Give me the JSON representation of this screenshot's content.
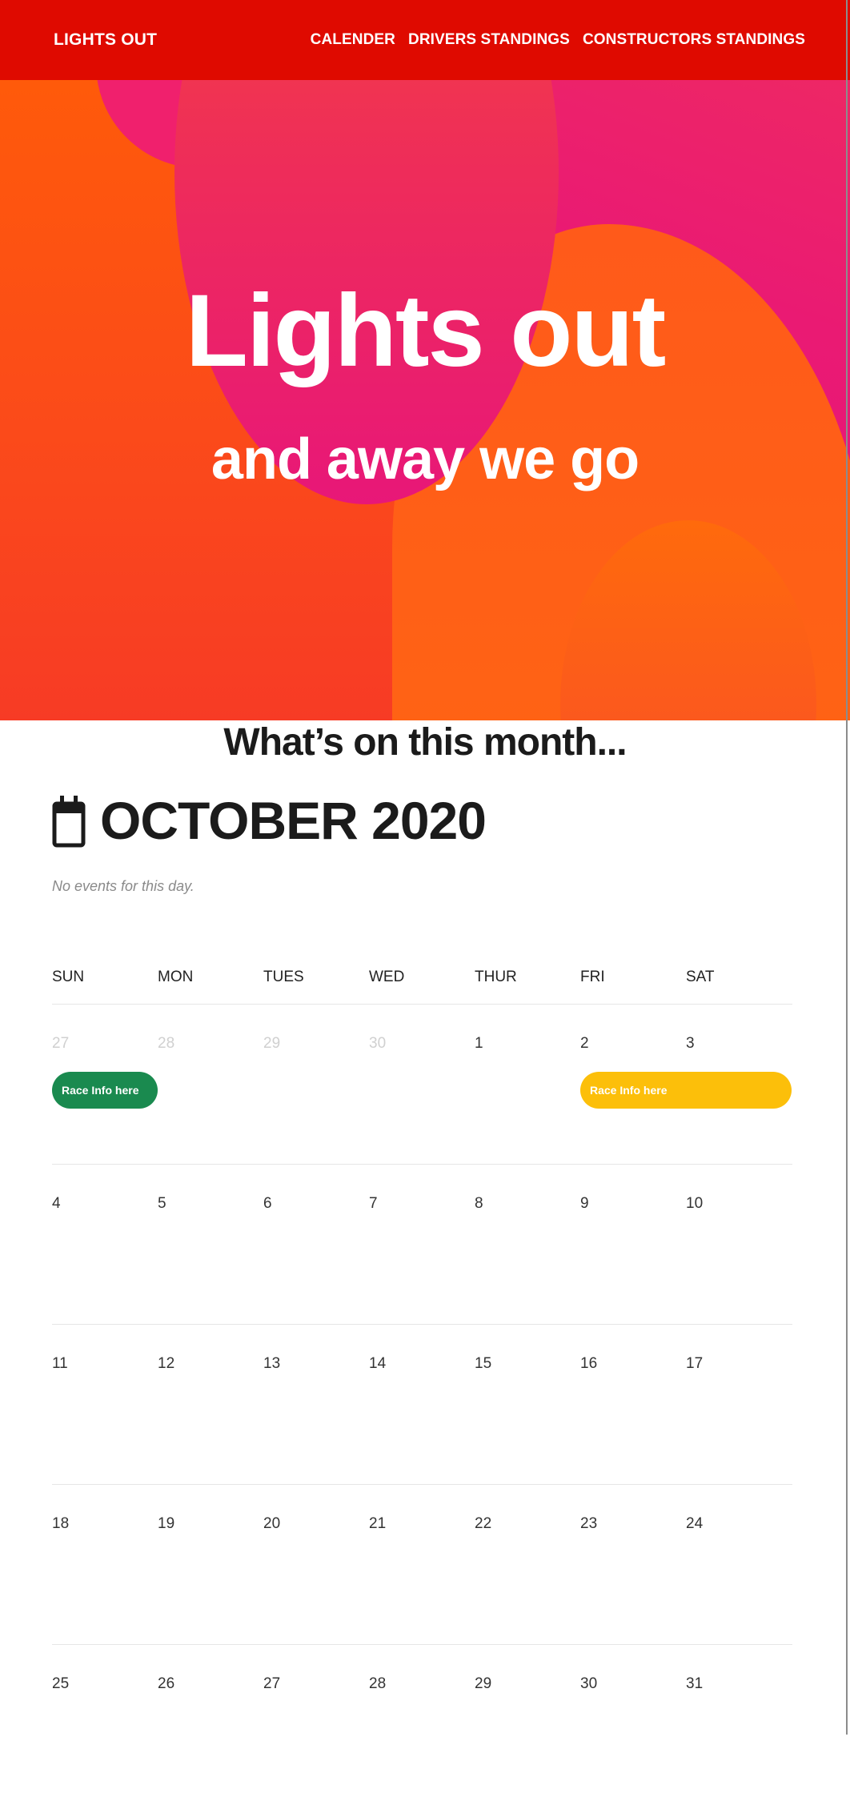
{
  "nav": {
    "brand": "LIGHTS OUT",
    "links": [
      "CALENDER",
      "DRIVERS STANDINGS",
      "CONSTRUCTORS STANDINGS"
    ]
  },
  "hero": {
    "title": "Lights out",
    "subtitle": "and away we go"
  },
  "section": {
    "title": "What’s on this month...",
    "month": "OCTOBER 2020",
    "no_events": "No events for this day."
  },
  "calendar": {
    "weekdays": [
      "SUN",
      "MON",
      "TUES",
      "WED",
      "THUR",
      "FRI",
      "SAT"
    ],
    "weeks": [
      [
        "27",
        "28",
        "29",
        "30",
        "1",
        "2",
        "3"
      ],
      [
        "4",
        "5",
        "6",
        "7",
        "8",
        "9",
        "10"
      ],
      [
        "11",
        "12",
        "13",
        "14",
        "15",
        "16",
        "17"
      ],
      [
        "18",
        "19",
        "20",
        "21",
        "22",
        "23",
        "24"
      ],
      [
        "25",
        "26",
        "27",
        "28",
        "29",
        "30",
        "31"
      ]
    ],
    "muted_days": [
      "27",
      "28",
      "29",
      "30"
    ],
    "events": [
      {
        "label": "Race Info here",
        "color": "#1a8a4f"
      },
      {
        "label": "Race Info here",
        "color": "#fcbf0a"
      }
    ]
  },
  "colors": {
    "navbar": "#df0a00",
    "hero_orange": "#ff5a0a",
    "hero_pink": "#e81778"
  }
}
